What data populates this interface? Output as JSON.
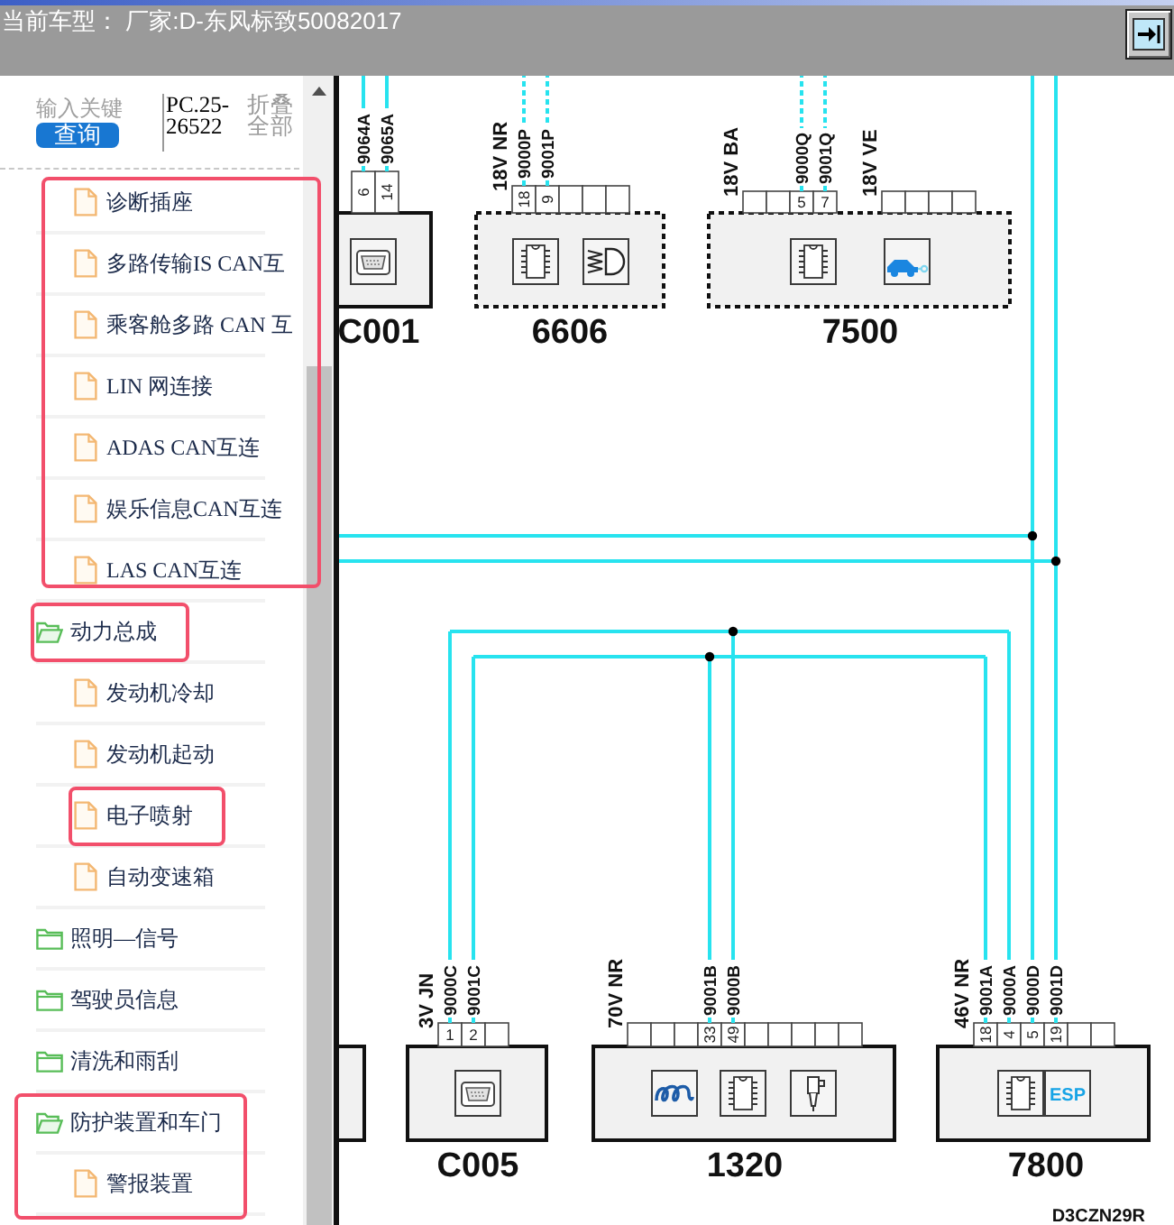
{
  "header": {
    "title": "当前车型： 厂家:D-东风标致50082017"
  },
  "sidebar": {
    "search": {
      "placeholder": "输入关键",
      "button": "查询"
    },
    "document_code": "PC.25-26522",
    "collapse_all": "折叠全部",
    "tree": [
      {
        "branch_highlighted": true,
        "children": [
          {
            "kind": "file",
            "label": "诊断插座",
            "selected": false,
            "highlighted": false
          },
          {
            "kind": "file",
            "label": "多路传输IS CAN互",
            "selected": false,
            "highlighted": false
          },
          {
            "kind": "file",
            "label": "乘客舱多路 CAN 互",
            "selected": false,
            "highlighted": false
          },
          {
            "kind": "file",
            "label": "LIN 网连接",
            "selected": false,
            "highlighted": false
          },
          {
            "kind": "file",
            "label": "ADAS CAN互连",
            "selected": false,
            "highlighted": false
          },
          {
            "kind": "file",
            "label": "娱乐信息CAN互连",
            "selected": false,
            "highlighted": false
          },
          {
            "kind": "file",
            "label": "LAS CAN互连",
            "selected": false,
            "highlighted": false
          }
        ]
      },
      {
        "kind": "folder",
        "label": "动力总成",
        "expanded": true,
        "selected": false,
        "highlighted": true,
        "branch_highlighted": false,
        "children": [
          {
            "kind": "file",
            "label": "发动机冷却",
            "selected": false,
            "highlighted": false
          },
          {
            "kind": "file",
            "label": "发动机起动",
            "selected": false,
            "highlighted": false
          },
          {
            "kind": "file",
            "label": "电子喷射",
            "selected": false,
            "highlighted": true
          },
          {
            "kind": "file",
            "label": "自动变速箱",
            "selected": false,
            "highlighted": false
          }
        ]
      },
      {
        "kind": "folder",
        "label": "照明—信号",
        "expanded": false,
        "selected": false,
        "highlighted": false,
        "branch_highlighted": false
      },
      {
        "kind": "folder",
        "label": "驾驶员信息",
        "expanded": false,
        "selected": false,
        "highlighted": false,
        "branch_highlighted": false
      },
      {
        "kind": "folder",
        "label": "清洗和雨刮",
        "expanded": false,
        "selected": false,
        "highlighted": false,
        "branch_highlighted": false
      },
      {
        "kind": "folder",
        "label": "防护装置和车门",
        "expanded": true,
        "selected": false,
        "highlighted": false,
        "branch_highlighted": true,
        "children": [
          {
            "kind": "file",
            "label": "警报装置",
            "selected": false,
            "highlighted": false
          }
        ]
      }
    ]
  },
  "diagram": {
    "components": [
      {
        "label": "C001",
        "dashed": false,
        "connectors": [
          {
            "dashed_wires": false,
            "pins": [
              {
                "used": true,
                "number": "6",
                "wire": "9064A"
              },
              {
                "used": true,
                "number": "14",
                "wire": "9065A"
              }
            ]
          }
        ]
      },
      {
        "label": "6606",
        "dashed": true,
        "connectors": [
          {
            "voltage": "18V NR",
            "dashed_wires": true,
            "pins": [
              {
                "used": true,
                "number": "18",
                "wire": "9000P"
              },
              {
                "used": true,
                "number": "9",
                "wire": "9001P"
              },
              {
                "used": false
              },
              {
                "used": false
              },
              {
                "used": false
              }
            ]
          }
        ]
      },
      {
        "label": "7500",
        "dashed": true,
        "connectors": [
          {
            "voltage": "18V BA",
            "dashed_wires": true,
            "pins": [
              {
                "used": false
              },
              {
                "used": false
              },
              {
                "used": true,
                "number": "5",
                "wire": "9000Q"
              },
              {
                "used": true,
                "number": "7",
                "wire": "9001Q"
              }
            ]
          },
          {
            "voltage": "18V VE",
            "pins": [
              {
                "used": false
              },
              {
                "used": false
              },
              {
                "used": false
              },
              {
                "used": false
              }
            ]
          }
        ]
      },
      {
        "label": "C005",
        "dashed": false,
        "connectors": [
          {
            "voltage": "3V JN",
            "dashed_wires": false,
            "pins": [
              {
                "used": true,
                "number": "1",
                "wire": "9000C"
              },
              {
                "used": true,
                "number": "2",
                "wire": "9001C"
              },
              {
                "used": false
              }
            ]
          }
        ]
      },
      {
        "label": "1320",
        "dashed": false,
        "connectors": [
          {
            "voltage": "70V NR",
            "dashed_wires": false,
            "pins": [
              {
                "used": false
              },
              {
                "used": false
              },
              {
                "used": false
              },
              {
                "used": true,
                "number": "33",
                "wire": "9001B"
              },
              {
                "used": true,
                "number": "49",
                "wire": "9000B"
              },
              {
                "used": false
              },
              {
                "used": false
              },
              {
                "used": false
              },
              {
                "used": false
              },
              {
                "used": false
              }
            ]
          }
        ]
      },
      {
        "label": "7800",
        "dashed": false,
        "module_tag": "ESP",
        "connectors": [
          {
            "voltage": "46V NR",
            "dashed_wires": false,
            "pins": [
              {
                "used": true,
                "number": "18",
                "wire": "9001A"
              },
              {
                "used": true,
                "number": "4",
                "wire": "9000A"
              },
              {
                "used": true,
                "number": "5",
                "wire": "9000D"
              },
              {
                "used": true,
                "number": "19",
                "wire": "9001D"
              },
              {
                "used": false
              },
              {
                "used": false
              }
            ]
          }
        ]
      }
    ],
    "drawing_code": "D3CZN29R"
  }
}
